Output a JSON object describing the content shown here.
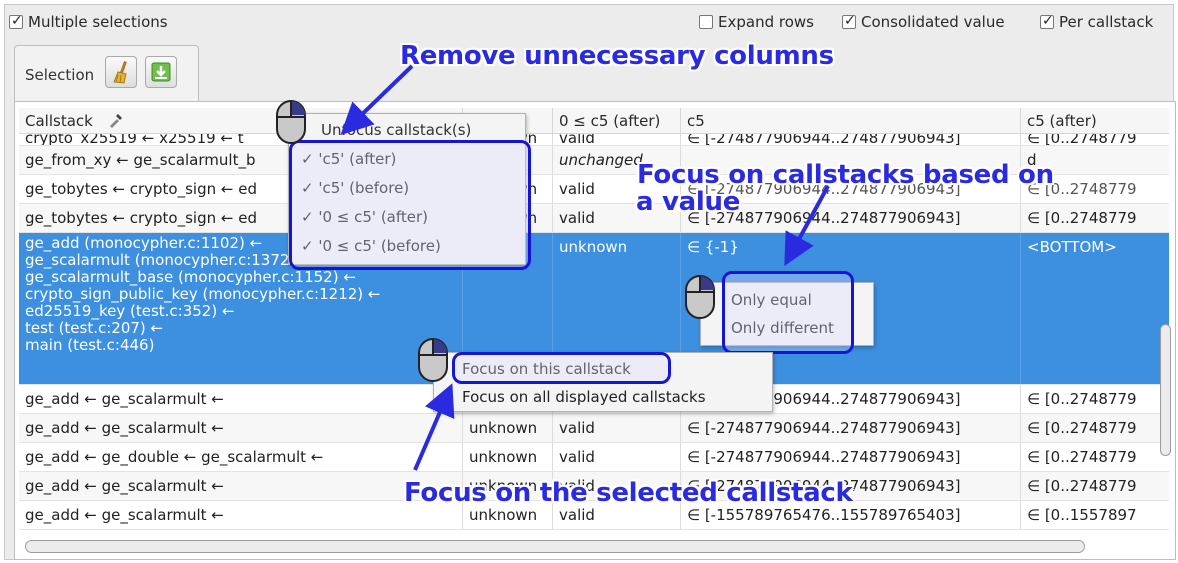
{
  "topbar": {
    "multiple_selections": "Multiple selections",
    "expand_rows": "Expand rows",
    "consolidated_value": "Consolidated value",
    "per_callstack": "Per callstack"
  },
  "selection_tab": {
    "label": "Selection",
    "clear_icon": "broom-icon",
    "export_icon": "download-icon"
  },
  "columns": [
    "Callstack",
    "0 ≤ c5",
    "0 ≤ c5 (after)",
    "c5",
    "c5 (after)"
  ],
  "rows": [
    {
      "callstack": "crypto_x25519 ← x25519 ← t",
      "a": "unknown",
      "b": "valid",
      "c": "∈ [-274877906944..274877906943]",
      "d": "∈ [0..2748779"
    },
    {
      "callstack": "ge_from_xy ← ge_scalarmult_b",
      "a": "",
      "b": "unchanged",
      "c": "",
      "d": "d"
    },
    {
      "callstack": "ge_tobytes ← crypto_sign ← ed",
      "a": "unknown",
      "b": "valid",
      "c": "∈ [-274877906944..274877906943]",
      "d": "∈ [0..2748779"
    },
    {
      "callstack": "ge_tobytes ← crypto_sign ← ed",
      "a": "unknown",
      "b": "valid",
      "c": "∈ [-274877906944..274877906943]",
      "d": "∈ [0..2748779"
    },
    {
      "callstack": "ge_add (monocypher.c:1102) ←\nge_scalarmult (monocypher.c:1372) ←\nge_scalarmult_base (monocypher.c:1152) ←\ncrypto_sign_public_key (monocypher.c:1212) ←\ned25519_key (test.c:352) ←\ntest (test.c:207) ←\nmain (test.c:446)",
      "a": "",
      "b": "unknown",
      "c": "∈ {-1}",
      "d": "<BOTTOM>"
    },
    {
      "callstack": "ge_add ← ge_scalarmult ←",
      "a": "",
      "b": "",
      "c": "∈ [-274877906944..274877906943]",
      "d": "∈ [0..2748779"
    },
    {
      "callstack": "ge_add ← ge_scalarmult ←",
      "a": "unknown",
      "b": "valid",
      "c": "∈ [-274877906944..274877906943]",
      "d": "∈ [0..2748779"
    },
    {
      "callstack": "ge_add ← ge_double ← ge_scalarmult ←",
      "a": "unknown",
      "b": "valid",
      "c": "∈ [-274877906944..274877906943]",
      "d": "∈ [0..2748779"
    },
    {
      "callstack": "ge_add ← ge_scalarmult ←",
      "a": "unknown",
      "b": "valid",
      "c": "∈ [-274877906944..274877906943]",
      "d": "∈ [0..2748779"
    },
    {
      "callstack": "ge_add ← ge_scalarmult ←",
      "a": "unknown",
      "b": "valid",
      "c": "∈ [-155789765476..155789765403]",
      "d": "∈ [0..1557897"
    }
  ],
  "menu_columns": {
    "unfocus": "Unfocus callstack(s)",
    "items": [
      "'c5'  (after)",
      "'c5'  (before)",
      "'0 ≤ c5'  (after)",
      "'0 ≤ c5'  (before)"
    ],
    "check": "✓"
  },
  "menu_value": {
    "items": [
      "Only equal",
      "Only different"
    ]
  },
  "menu_callstack": {
    "items": [
      "Focus on this callstack",
      "Focus on all displayed callstacks"
    ]
  },
  "annotations": {
    "remove_columns": "Remove unnecessary columns",
    "focus_value_line1": "Focus on callstacks based on",
    "focus_value_line2": "a value",
    "focus_selected": "Focus on the selected callstack"
  },
  "colors": {
    "selection": "#3d8fe0",
    "annotation": "#2a2ae0",
    "highlight_border": "#1515d8"
  }
}
